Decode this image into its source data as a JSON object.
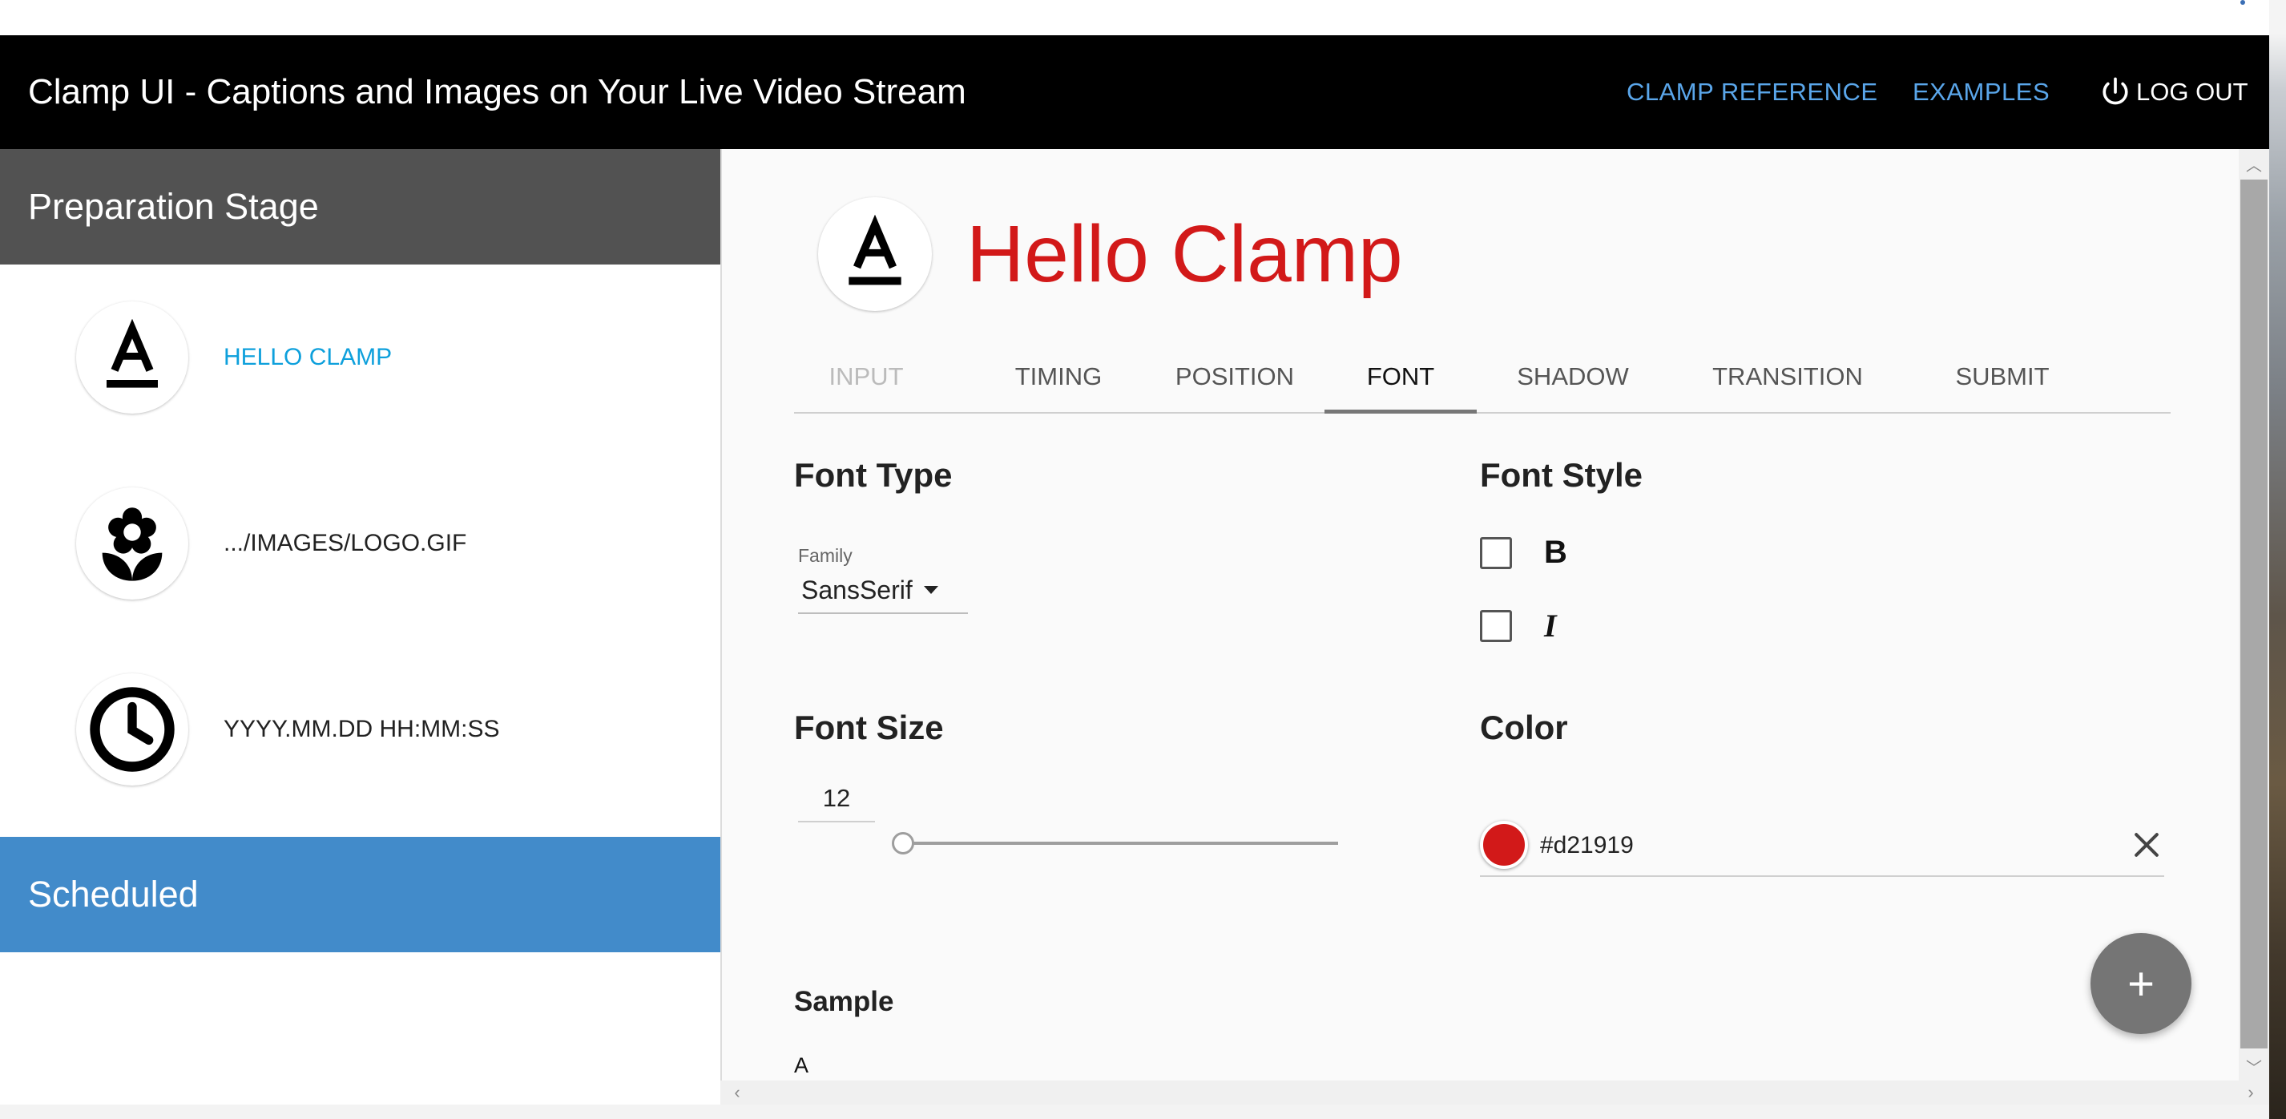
{
  "app": {
    "title": "Clamp UI - Captions and Images on Your Live Video Stream",
    "nav": [
      "CLAMP REFERENCE",
      "EXAMPLES"
    ],
    "logout_label": "LOG OUT",
    "logout_icon": "power-icon"
  },
  "sidebar": {
    "header": "Preparation Stage",
    "items": [
      {
        "label": "HELLO CLAMP",
        "icon": "text-format-icon",
        "active": true
      },
      {
        "label": ".../IMAGES/LOGO.GIF",
        "icon": "flower-icon",
        "active": false
      },
      {
        "label": "YYYY.MM.DD HH:MM:SS",
        "icon": "clock-icon",
        "active": false
      }
    ],
    "scheduled": "Scheduled"
  },
  "editor": {
    "title": "Hello Clamp",
    "title_icon": "text-format-icon",
    "tabs": [
      {
        "label": "INPUT",
        "state": "disabled"
      },
      {
        "label": "TIMING",
        "state": "normal"
      },
      {
        "label": "POSITION",
        "state": "normal"
      },
      {
        "label": "FONT",
        "state": "active"
      },
      {
        "label": "SHADOW",
        "state": "normal"
      },
      {
        "label": "TRANSITION",
        "state": "normal"
      },
      {
        "label": "SUBMIT",
        "state": "normal"
      }
    ],
    "font_type": {
      "title": "Font Type",
      "family_label": "Family",
      "family_value": "SansSerif"
    },
    "font_style": {
      "title": "Font Style",
      "bold_label": "B",
      "bold_checked": false,
      "italic_label": "I",
      "italic_checked": false
    },
    "font_size": {
      "title": "Font Size",
      "value": "12",
      "slider_fraction": 0.0
    },
    "color": {
      "title": "Color",
      "value": "#d21919"
    },
    "sample": {
      "title": "Sample",
      "text": "A"
    },
    "fab_label": "+"
  },
  "colors": {
    "accent_link": "#5aa6ea",
    "active_item": "#0ea0dc",
    "scheduled_bg": "#428bca",
    "preparation_bg": "#525252",
    "caption_color": "#d21919"
  }
}
